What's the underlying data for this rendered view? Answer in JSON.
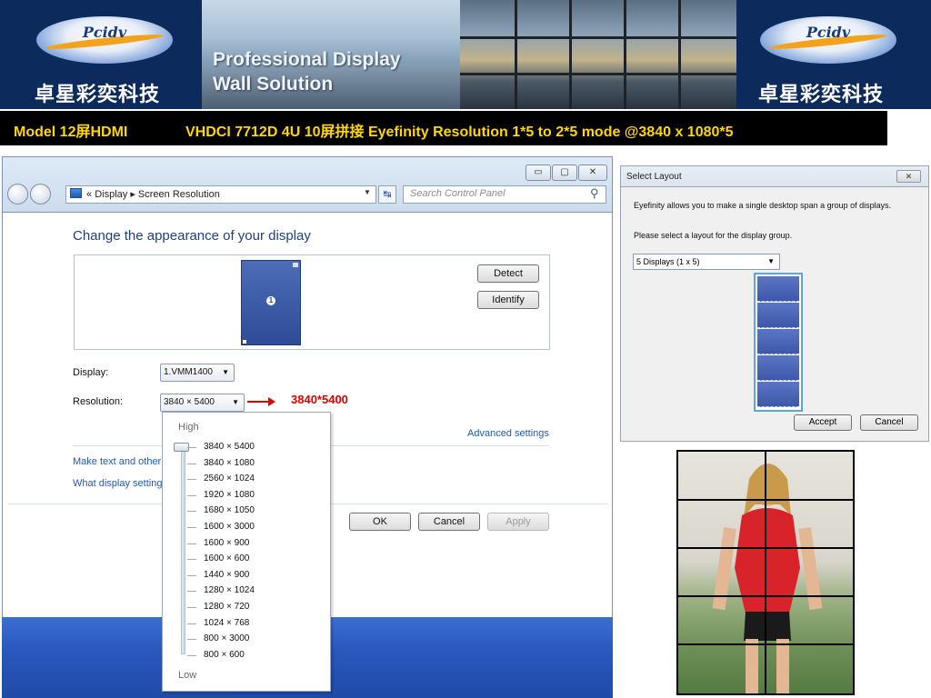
{
  "banner": {
    "brand_name": "Pcidv",
    "brand_cn": "卓星彩奕科技",
    "title_line1": "Professional Display",
    "title_line2": "Wall Solution"
  },
  "caption": {
    "left": "Model 12屏HDMI",
    "right": "VHDCI 7712D 4U 10屏拼接 Eyefinity Resolution 1*5 to 2*5 mode @3840 x 1080*5"
  },
  "window": {
    "controls": {
      "minimize": "▭",
      "maximize": "▢",
      "close": "✕"
    },
    "breadcrumb": {
      "prefix": "«",
      "item1": "Display",
      "sep": "▸",
      "item2": "Screen Resolution"
    },
    "search_placeholder": "Search Control Panel",
    "heading": "Change the appearance of your display",
    "monitor_number": "1",
    "detect_label": "Detect",
    "identify_label": "Identify",
    "display_label": "Display:",
    "display_value": "1.VMM1400",
    "resolution_label": "Resolution:",
    "resolution_value": "3840 × 5400",
    "advanced_settings": "Advanced settings",
    "link_text_size": "Make text and other",
    "link_display_settings": "What display setting",
    "ok_label": "OK",
    "cancel_label": "Cancel",
    "apply_label": "Apply",
    "resolution_dropdown": {
      "high_label": "High",
      "low_label": "Low",
      "options": [
        "3840 × 5400",
        "3840 × 1080",
        "2560 × 1024",
        "1920 × 1080",
        "1680 × 1050",
        "1600 × 3000",
        "1600 × 900",
        "1600 × 600",
        "1440 × 900",
        "1280 × 1024",
        "1280 × 720",
        "1024 × 768",
        "800 × 3000",
        "800 × 600"
      ],
      "selected_index": 0
    }
  },
  "annotation": {
    "note": "3840*5400",
    "color": "#e00000"
  },
  "select_layout": {
    "title": "Select Layout",
    "close": "✕",
    "desc1": "Eyefinity allows you to make a single desktop span a group of displays.",
    "desc2": "Please select a layout for the display group.",
    "combo_value": "5 Displays (1 x 5)",
    "accept_label": "Accept",
    "cancel_label": "Cancel",
    "layout_rows": 5
  },
  "wall_photo": {
    "columns": 2,
    "rows": 5
  },
  "colors": {
    "banner_bg": "#0d2a5c",
    "caption_text": "#ffd700",
    "link": "#1c5ab8",
    "heading": "#1e3f86"
  }
}
